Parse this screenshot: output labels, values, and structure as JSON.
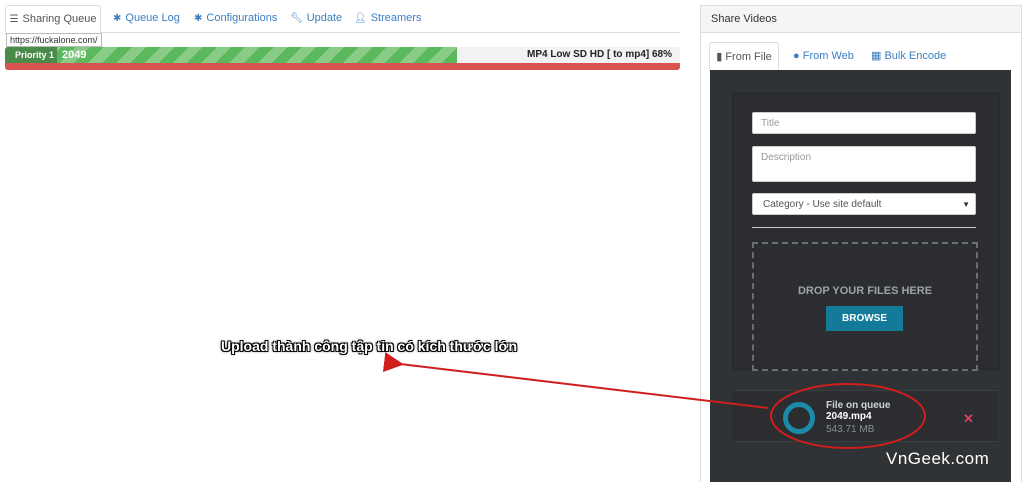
{
  "tabs": [
    {
      "label": "Sharing Queue",
      "icon": "server-icon"
    },
    {
      "label": "Queue Log",
      "icon": "gear-icon"
    },
    {
      "label": "Configurations",
      "icon": "gear-icon"
    },
    {
      "label": "Update",
      "icon": "wrench-icon"
    },
    {
      "label": "Streamers",
      "icon": "user-icon"
    }
  ],
  "tooltip": "https://fuckalone.com/",
  "progress": {
    "priority": "Priority 1",
    "count": "2049",
    "text": "MP4 Low SD HD [ to mp4] 68%",
    "fraction": 0.67
  },
  "panel": {
    "title": "Share Videos",
    "tabs": [
      {
        "label": "From File",
        "icon": "file-icon"
      },
      {
        "label": "From Web",
        "icon": "globe-icon"
      },
      {
        "label": "Bulk Encode",
        "icon": "cubes-icon"
      }
    ],
    "form": {
      "title_placeholder": "Title",
      "description_placeholder": "Description",
      "category": "Category - Use site default"
    },
    "drop_text": "DROP YOUR FILES HERE",
    "browse_label": "BROWSE",
    "queue": {
      "status": "File on queue",
      "filename": "2049.mp4",
      "size": "543.71 MB"
    }
  },
  "annotation": "Upload thành công tập tin có kích thước lớn",
  "watermark": "VnGeek.com",
  "colors": {
    "accent": "#147a9a",
    "progress_green": "#5cb85c",
    "progress_red": "#d9534f",
    "annotation_red": "#d01e1e"
  }
}
